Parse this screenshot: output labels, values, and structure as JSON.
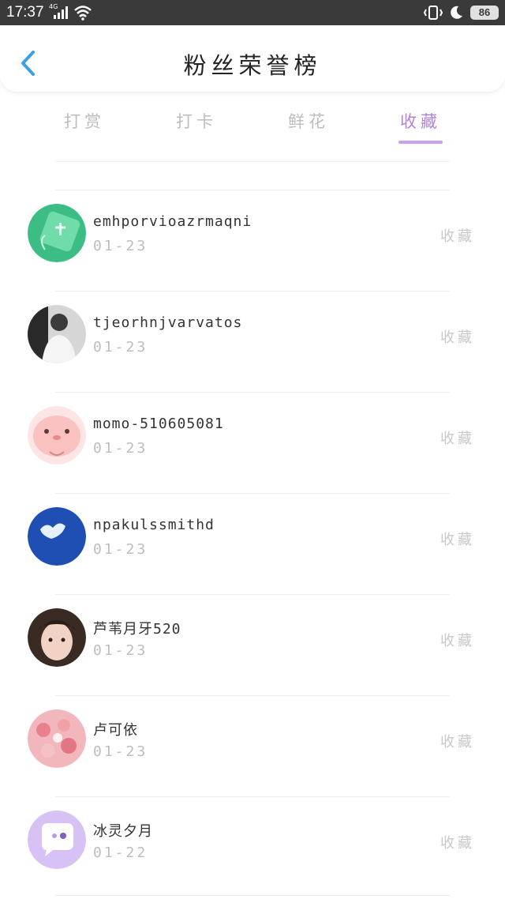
{
  "status_bar": {
    "time": "17:37",
    "network": "4G",
    "battery": "86"
  },
  "header": {
    "title": "粉丝荣誉榜",
    "back_icon": "chevron-left-icon"
  },
  "tabs": [
    {
      "label": "打赏",
      "active": false
    },
    {
      "label": "打卡",
      "active": false
    },
    {
      "label": "鲜花",
      "active": false
    },
    {
      "label": "收藏",
      "active": true
    }
  ],
  "colors": {
    "accent": "#b284d6",
    "indicator": "#c9a2e6",
    "muted": "#bdbdbd"
  },
  "fans": [
    {
      "name": "emhporvioazrmaqni",
      "date": "01-23",
      "type": "收藏",
      "avatar": "green-gift-avatar"
    },
    {
      "name": "tjeorhnjvarvatos",
      "date": "01-23",
      "type": "收藏",
      "avatar": "person-photo-avatar"
    },
    {
      "name": "momo-510605081",
      "date": "01-23",
      "type": "收藏",
      "avatar": "pink-cartoon-avatar"
    },
    {
      "name": "npakulssmithd",
      "date": "01-23",
      "type": "收藏",
      "avatar": "blue-sky-cloud-avatar"
    },
    {
      "name": "芦苇月牙520",
      "date": "01-23",
      "type": "收藏",
      "avatar": "girl-photo-avatar"
    },
    {
      "name": "卢可依",
      "date": "01-23",
      "type": "收藏",
      "avatar": "pink-flowers-avatar"
    },
    {
      "name": "冰灵夕月",
      "date": "01-22",
      "type": "收藏",
      "avatar": "purple-chat-avatar"
    }
  ]
}
